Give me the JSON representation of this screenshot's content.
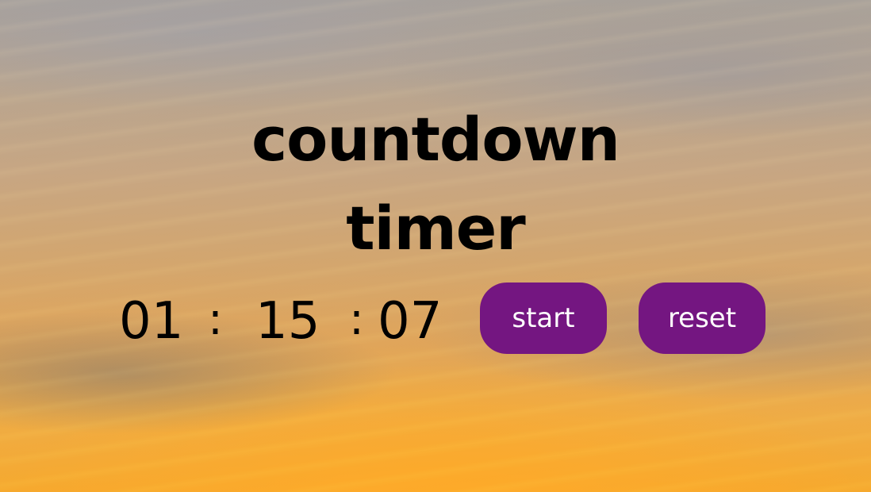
{
  "title": {
    "line1": "countdown",
    "line2": "timer"
  },
  "timer": {
    "hours": "01",
    "minutes": "15",
    "seconds": "07",
    "separator": ":"
  },
  "buttons": {
    "start_label": "start",
    "reset_label": "reset"
  },
  "colors": {
    "button_bg": "#741681",
    "button_text": "#ffffff",
    "text": "#000000"
  }
}
